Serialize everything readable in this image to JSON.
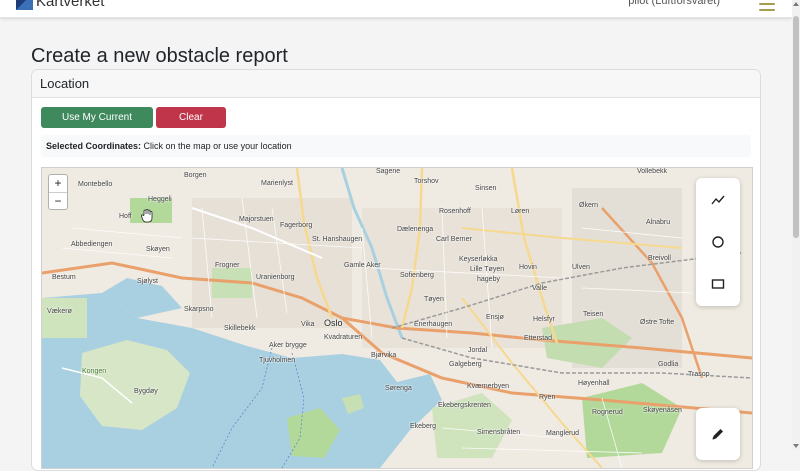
{
  "navbar": {
    "brand_name": "Kartverket",
    "user_label": "pilot (Luftforsvaret)"
  },
  "page": {
    "title": "Create a new obstacle report"
  },
  "location_card": {
    "header": "Location",
    "use_location_label": "Use My Current Location",
    "clear_location_label": "Clear Location",
    "coords_label": "Selected Coordinates:",
    "coords_hint": "Click on the map or use your location"
  },
  "map": {
    "zoom_in": "+",
    "zoom_out": "−",
    "labels": {
      "montebello": "Montebello",
      "borgen": "Borgen",
      "heggeli": "Heggeli",
      "hoff": "Hoff",
      "marienlyst": "Marienlyst",
      "fagerborg": "Fagerborg",
      "sagene": "Sagene",
      "torshov": "Torshov",
      "sinsen": "Sinsen",
      "volleberk": "Vollebekk",
      "majorstuen": "Majorstuen",
      "rosenhoff": "Rosenhoff",
      "loren": "Løren",
      "okern": "Økern",
      "alnabru": "Alnabru",
      "st_hanshaugen": "St. Hanshaugen",
      "dælenenga": "Dælenenga",
      "carl_berner": "Carl Berner",
      "abbediengen": "Abbediengen",
      "skoyen": "Skøyen",
      "skoyen2": "Skøyen",
      "gamle_aker": "Gamle Aker",
      "keyserlokka": "Keyserløkka",
      "ulven": "Ulven",
      "breivoll": "Breivoll",
      "frogner": "Frogner",
      "lille_toyen": "Lille Tøyen",
      "hovin": "Hovin",
      "bestum": "Bestum",
      "uranienborg": "Uranienborg",
      "sofienberg": "Sofienberg",
      "hageby": "hageby",
      "valle": "Valle",
      "sjolyst": "Sjølyst",
      "toyen": "Tøyen",
      "vækerø": "Vækerø",
      "skarpsno": "Skarpsno",
      "ensjo": "Ensjø",
      "helsfyr": "Helsfyr",
      "teisen": "Teisen",
      "vika": "Vika",
      "oslo": "Oslo",
      "enerhaugen": "Enerhaugen",
      "skillebekk": "Skillebekk",
      "kvadraturen": "Kvadraturen",
      "ostre_tofte": "Østre Tofte",
      "aker_brygge": "Aker brygge",
      "tjuvholmen": "Tjuvholmen",
      "bjorvika": "Bjørvika",
      "jordal": "Jordal",
      "etterstad": "Etterstad",
      "godlia": "Godlia",
      "galgeberg": "Galgeberg",
      "kongen": "Kongen",
      "bygdoy": "Bygdøy",
      "sorenga": "Sørenga",
      "kvaernerbyen": "Kværnerbyen",
      "hoyenhall": "Høyenhall",
      "trasop": "Trasop",
      "ekebergskrenten": "Ekebergskrenten",
      "ryen": "Ryen",
      "rognerud": "Rognerud",
      "skoyenasen": "Skøyenåsen",
      "ekeberg": "Ekeberg",
      "simensbraten": "Simensbråten",
      "manglerud": "Manglerud"
    }
  },
  "icons": {
    "brand": "kartverket-logo-icon",
    "menu": "hamburger-menu-icon",
    "polyline": "polyline-icon",
    "circle": "circle-icon",
    "rectangle": "rectangle-icon",
    "edit": "pencil-icon",
    "cursor": "hand-cursor-icon"
  },
  "colors": {
    "success": "#3f8a5d",
    "danger": "#c0354a",
    "water": "#a9d0e1",
    "park": "#b3d99a"
  }
}
